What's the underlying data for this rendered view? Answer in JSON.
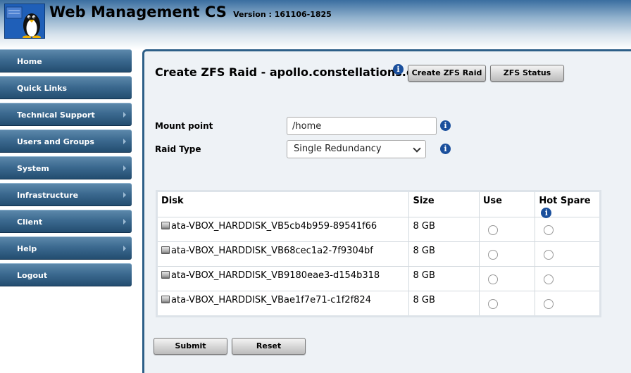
{
  "header": {
    "title": "Web Management CS",
    "version": "Version : 161106-1825",
    "logo_icon": "tux-penguin-logo"
  },
  "sidebar": {
    "items": [
      {
        "label": "Home",
        "submenu": false
      },
      {
        "label": "Quick Links",
        "submenu": false
      },
      {
        "label": "Technical Support",
        "submenu": true
      },
      {
        "label": "Users and Groups",
        "submenu": true
      },
      {
        "label": "System",
        "submenu": true
      },
      {
        "label": "Infrastructure",
        "submenu": true
      },
      {
        "label": "Client",
        "submenu": true
      },
      {
        "label": "Help",
        "submenu": true
      },
      {
        "label": "Logout",
        "submenu": false
      }
    ]
  },
  "main": {
    "title": "Create ZFS Raid - apollo.constellations.com",
    "buttons": {
      "create": "Create ZFS Raid",
      "status": "ZFS Status"
    },
    "form": {
      "mount_label": "Mount point",
      "mount_value": "/home",
      "raid_label": "Raid Type",
      "raid_value": "Single Redundancy"
    },
    "table": {
      "headers": {
        "disk": "Disk",
        "size": "Size",
        "use": "Use",
        "hot_spare": "Hot Spare"
      },
      "rows": [
        {
          "disk": "ata-VBOX_HARDDISK_VB5cb4b959-89541f66",
          "size": "8 GB"
        },
        {
          "disk": "ata-VBOX_HARDDISK_VB68cec1a2-7f9304bf",
          "size": "8 GB"
        },
        {
          "disk": "ata-VBOX_HARDDISK_VB9180eae3-d154b318",
          "size": "8 GB"
        },
        {
          "disk": "ata-VBOX_HARDDISK_VBae1f7e71-c1f2f824",
          "size": "8 GB"
        }
      ]
    },
    "actions": {
      "submit": "Submit",
      "reset": "Reset"
    }
  },
  "colors": {
    "nav": "#3c6a90",
    "panel_border": "#2d5f88",
    "panel_bg": "#eef2f6",
    "info": "#1a4f9c"
  }
}
